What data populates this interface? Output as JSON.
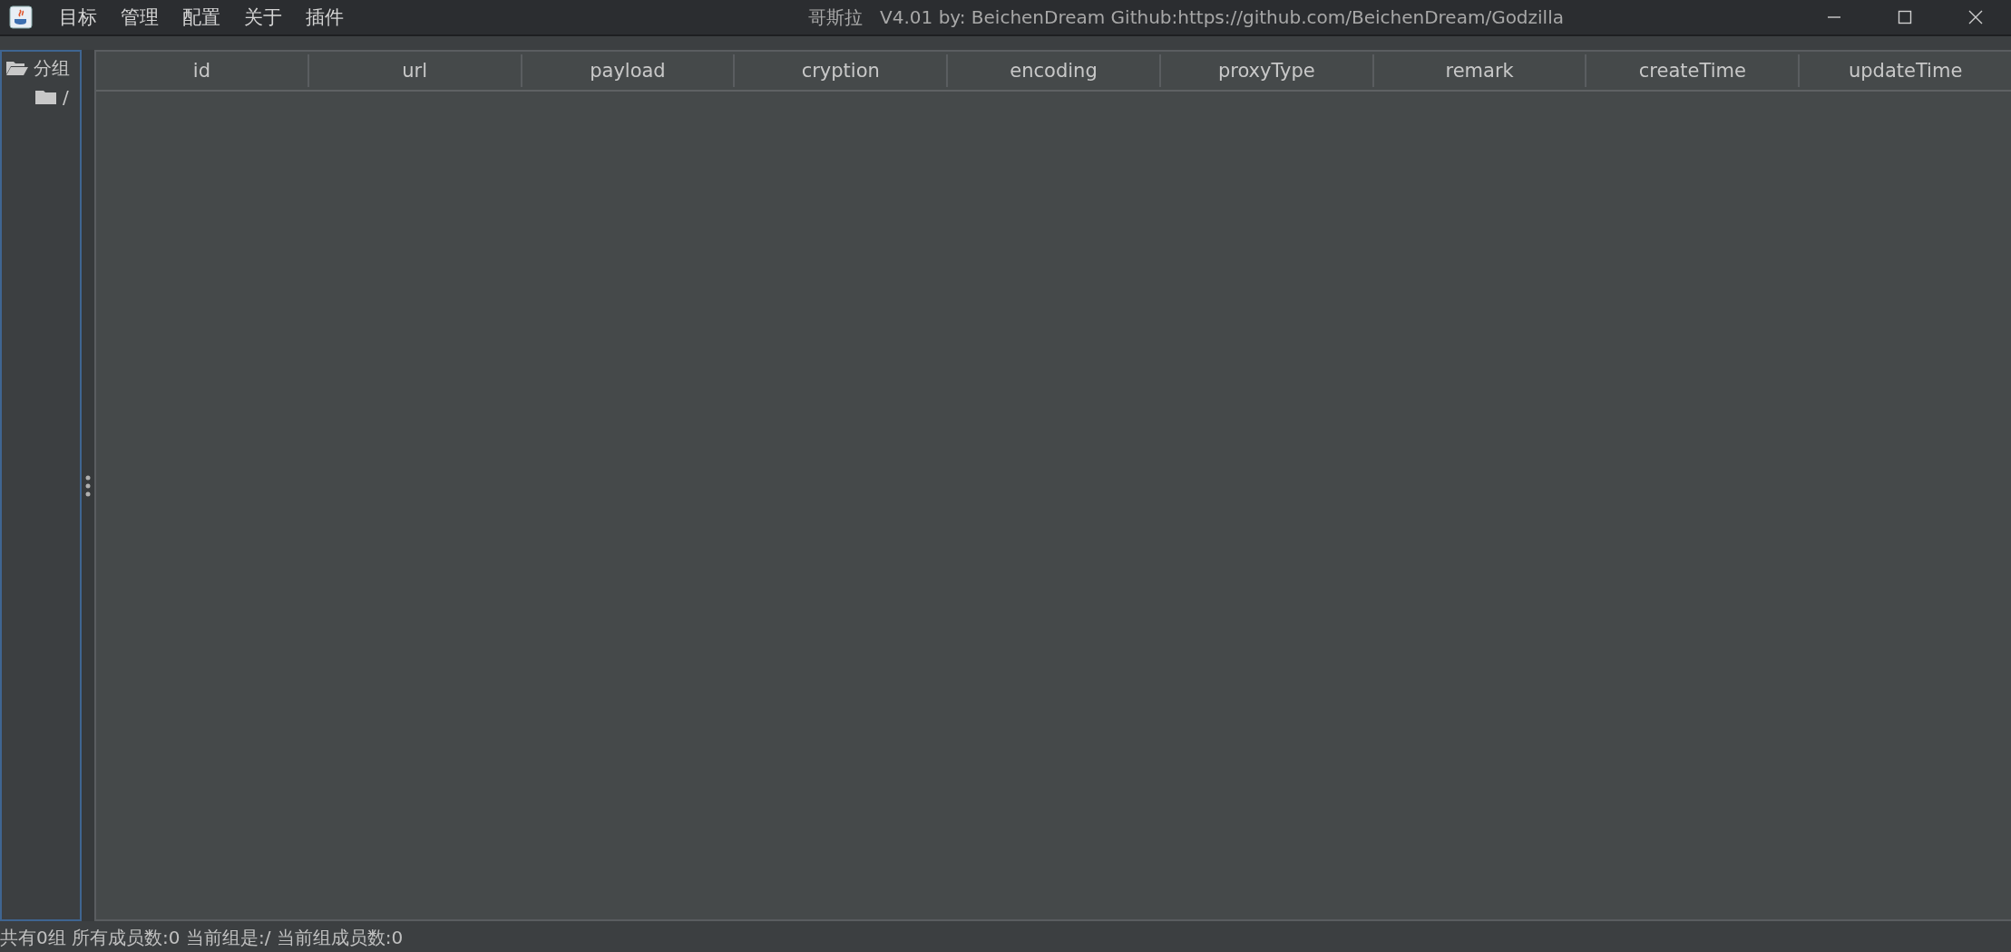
{
  "window": {
    "title": "哥斯拉   V4.01 by: BeichenDream Github:https://github.com/BeichenDream/Godzilla"
  },
  "menu": [
    "目标",
    "管理",
    "配置",
    "关于",
    "插件"
  ],
  "tree": [
    {
      "label": "分组",
      "expanded": true,
      "children": [
        {
          "label": "/",
          "expanded": false
        }
      ]
    }
  ],
  "table": {
    "columns": [
      "id",
      "url",
      "payload",
      "cryption",
      "encoding",
      "proxyType",
      "remark",
      "createTime",
      "updateTime"
    ]
  },
  "status_bar": "共有0组 所有成员数:0 当前组是:/ 当前组成员数:0"
}
